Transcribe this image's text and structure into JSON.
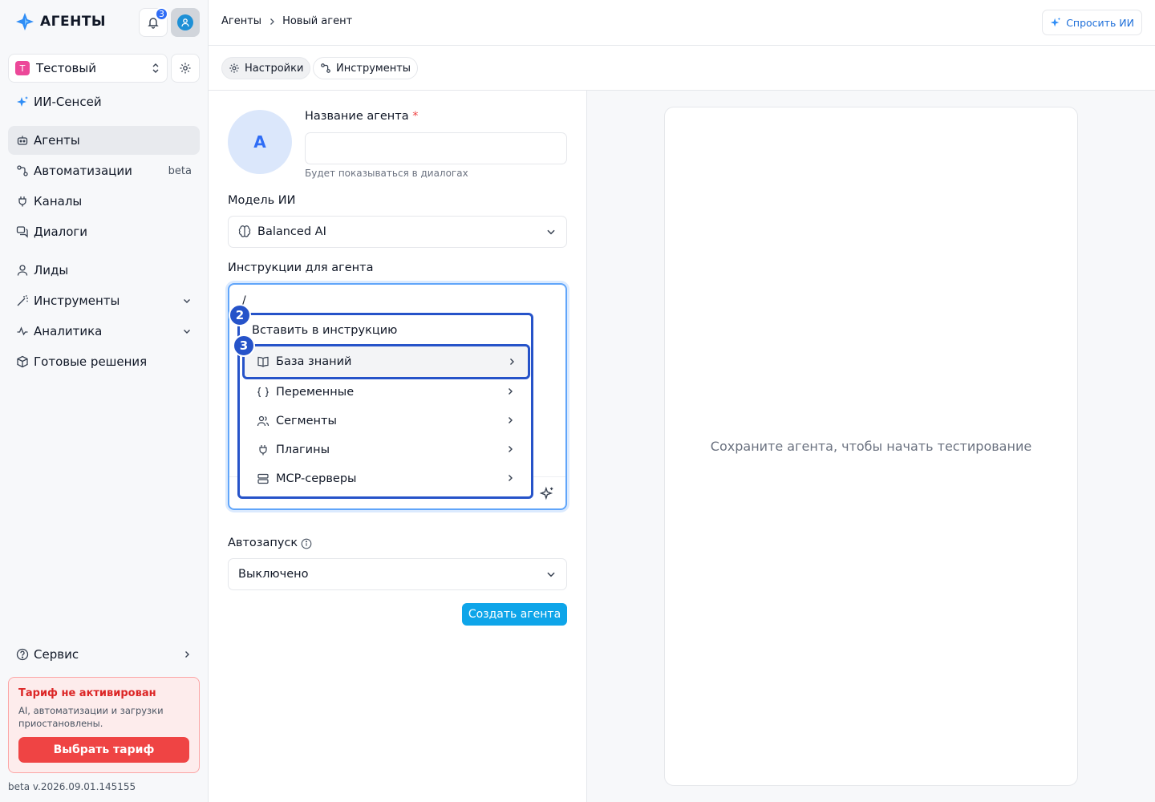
{
  "sidebar": {
    "brand": "АГЕНТЫ",
    "notifications_count": "3",
    "workspace": {
      "badge": "Т",
      "name": "Тестовый"
    },
    "ai_sensei": "ИИ-Сенсей",
    "items": [
      {
        "label": "Агенты",
        "icon": "bot-icon"
      },
      {
        "label": "Автоматизации",
        "icon": "workflow-icon",
        "badge": "beta"
      },
      {
        "label": "Каналы",
        "icon": "plug-icon"
      },
      {
        "label": "Диалоги",
        "icon": "chat-icon"
      },
      {
        "label": "Лиды",
        "icon": "user-icon"
      },
      {
        "label": "Инструменты",
        "icon": "wand-icon"
      },
      {
        "label": "Аналитика",
        "icon": "chart-icon"
      },
      {
        "label": "Готовые решения",
        "icon": "box-icon"
      }
    ],
    "service": "Сервис",
    "tariff": {
      "title": "Тариф не активирован",
      "description": "AI, автоматизации и загрузки приостановлены.",
      "button": "Выбрать тариф"
    },
    "version": "beta v.2026.09.01.145155"
  },
  "header": {
    "breadcrumbs": [
      "Агенты",
      "Новый агент"
    ],
    "ask_ai": "Спросить ИИ"
  },
  "tabs": [
    {
      "label": "Настройки",
      "active": true
    },
    {
      "label": "Инструменты",
      "active": false
    }
  ],
  "form": {
    "avatar_letter": "A",
    "name_label": "Название агента",
    "required_mark": "*",
    "name_value": "",
    "name_hint": "Будет показываться в диалогах",
    "model_label": "Модель ИИ",
    "model_value": "Balanced AI",
    "instructions_label": "Инструкции для агента",
    "instructions_value": "/",
    "autostart_label": "Автозапуск",
    "autostart_value": "Выключено",
    "create_button": "Создать агента"
  },
  "insert_menu": {
    "title": "Вставить в инструкцию",
    "items": [
      {
        "label": "База знаний",
        "icon": "book-icon",
        "selected": true
      },
      {
        "label": "Переменные",
        "icon": "braces-icon"
      },
      {
        "label": "Сегменты",
        "icon": "users-icon"
      },
      {
        "label": "Плагины",
        "icon": "plug-icon"
      },
      {
        "label": "MCP-серверы",
        "icon": "server-icon"
      }
    ],
    "markers": [
      "2",
      "3"
    ]
  },
  "preview": {
    "message": "Сохраните агента, чтобы начать тестирование"
  },
  "colors": {
    "accent": "#2f6df6",
    "primary_button": "#0ea5e9",
    "danger": "#ef4444",
    "annotation": "#2653c9"
  }
}
